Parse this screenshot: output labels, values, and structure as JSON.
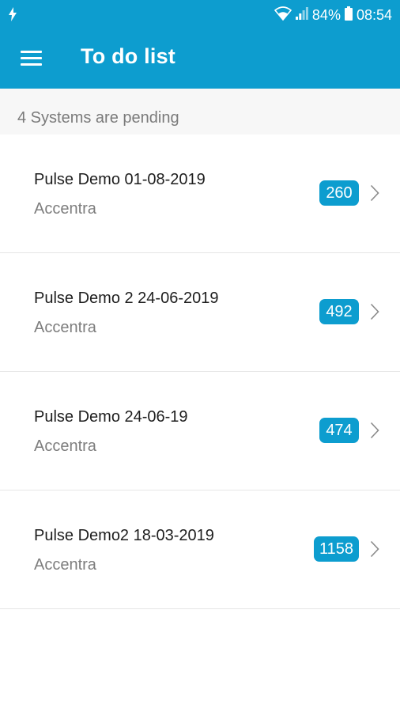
{
  "status_bar": {
    "battery": "84%",
    "time": "08:54"
  },
  "header": {
    "title": "To do list"
  },
  "summary": "4 Systems are pending",
  "systems": [
    {
      "name": "Pulse Demo 01-08-2019",
      "company": "Accentra",
      "count": "260"
    },
    {
      "name": "Pulse Demo 2 24-06-2019",
      "company": "Accentra",
      "count": "492"
    },
    {
      "name": "Pulse Demo 24-06-19",
      "company": "Accentra",
      "count": "474"
    },
    {
      "name": "Pulse Demo2 18-03-2019",
      "company": "Accentra",
      "count": "1158"
    }
  ],
  "colors": {
    "accent": "#0d9dcf",
    "title_text": "#1e1e1e",
    "secondary_text": "#7d7d7d"
  }
}
